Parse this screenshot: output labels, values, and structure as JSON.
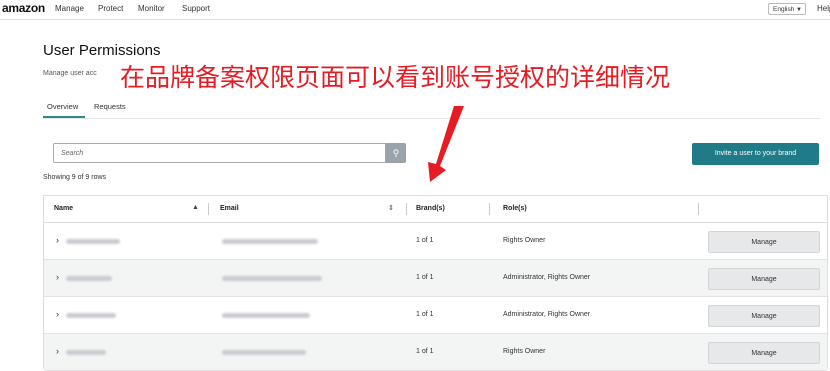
{
  "header": {
    "logo": "amazon",
    "nav": [
      "Manage",
      "Protect",
      "Monitor",
      "Support"
    ],
    "language": "English",
    "help": "Help"
  },
  "page": {
    "title": "User Permissions",
    "subtitle": "Manage user acc",
    "overlay_caption": "在品牌备案权限页面可以看到账号授权的详细情况"
  },
  "tabs": [
    "Overview",
    "Requests"
  ],
  "search": {
    "placeholder": "Search"
  },
  "invite_label": "Invite a user to your brand",
  "rows_count": "Showing 9 of 9 rows",
  "table": {
    "headers": [
      "Name",
      "Email",
      "Brand(s)",
      "Role(s)"
    ],
    "rows": [
      {
        "brands": "1 of 1",
        "roles": "Rights Owner",
        "action": "Manage"
      },
      {
        "brands": "1 of 1",
        "roles": "Administrator, Rights Owner",
        "action": "Manage"
      },
      {
        "brands": "1 of 1",
        "roles": "Administrator, Rights Owner",
        "action": "Manage"
      },
      {
        "brands": "1 of 1",
        "roles": "Rights Owner",
        "action": "Manage"
      }
    ]
  },
  "colors": {
    "accent": "#1f7b88",
    "annotation": "#e51c23"
  }
}
